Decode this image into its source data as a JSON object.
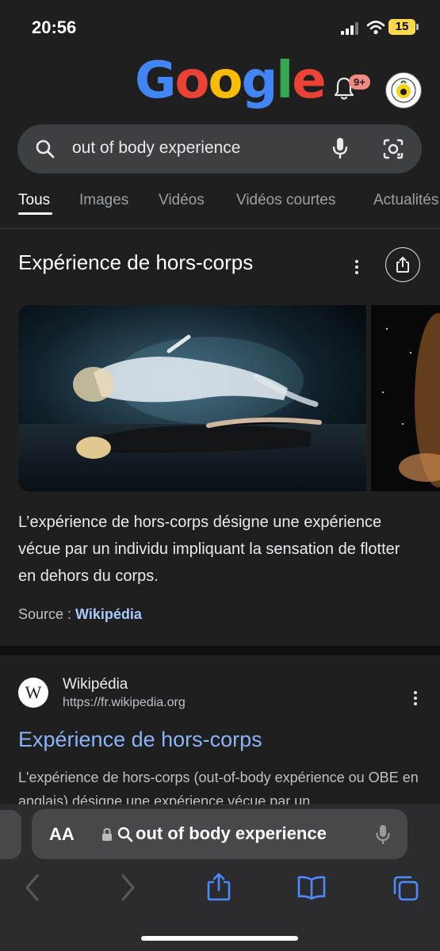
{
  "status_bar": {
    "time": "20:56",
    "battery": "15"
  },
  "google": {
    "logo": "Google",
    "notification_badge": "9+"
  },
  "search": {
    "query": "out of body experience"
  },
  "tabs": [
    {
      "label": "Tous"
    },
    {
      "label": "Images"
    },
    {
      "label": "Vidéos"
    },
    {
      "label": "Vidéos courtes"
    },
    {
      "label": "Actualités"
    }
  ],
  "knowledge_panel": {
    "title": "Expérience de hors-corps",
    "description": "L’expérience de hors-corps désigne une expérience vécue par un individu impliquant la sensation de flotter en dehors du corps.",
    "source_label": "Source : ",
    "source_link": "Wikipédia"
  },
  "result": {
    "site_name": "Wikipédia",
    "url": "https://fr.wikipedia.org",
    "title": "Expérience de hors-corps",
    "snippet": "L'expérience de hors-corps (out-of-body expérience ou OBE en anglais) désigne une expérience vécue par un"
  },
  "safari": {
    "aa_label": "AA",
    "address": "out of body experience"
  },
  "colors": {
    "background": "#1f1f1f",
    "link": "#8ab4f8",
    "source_link": "#a8c7fa",
    "safari_blue": "#4a8cff"
  },
  "icons": [
    "signal-icon",
    "wifi-icon",
    "battery-icon",
    "bell-icon",
    "search-icon",
    "mic-icon",
    "lens-icon",
    "more-icon",
    "share-icon",
    "lock-icon",
    "back-icon",
    "forward-icon",
    "bookmarks-icon",
    "tabs-icon"
  ]
}
